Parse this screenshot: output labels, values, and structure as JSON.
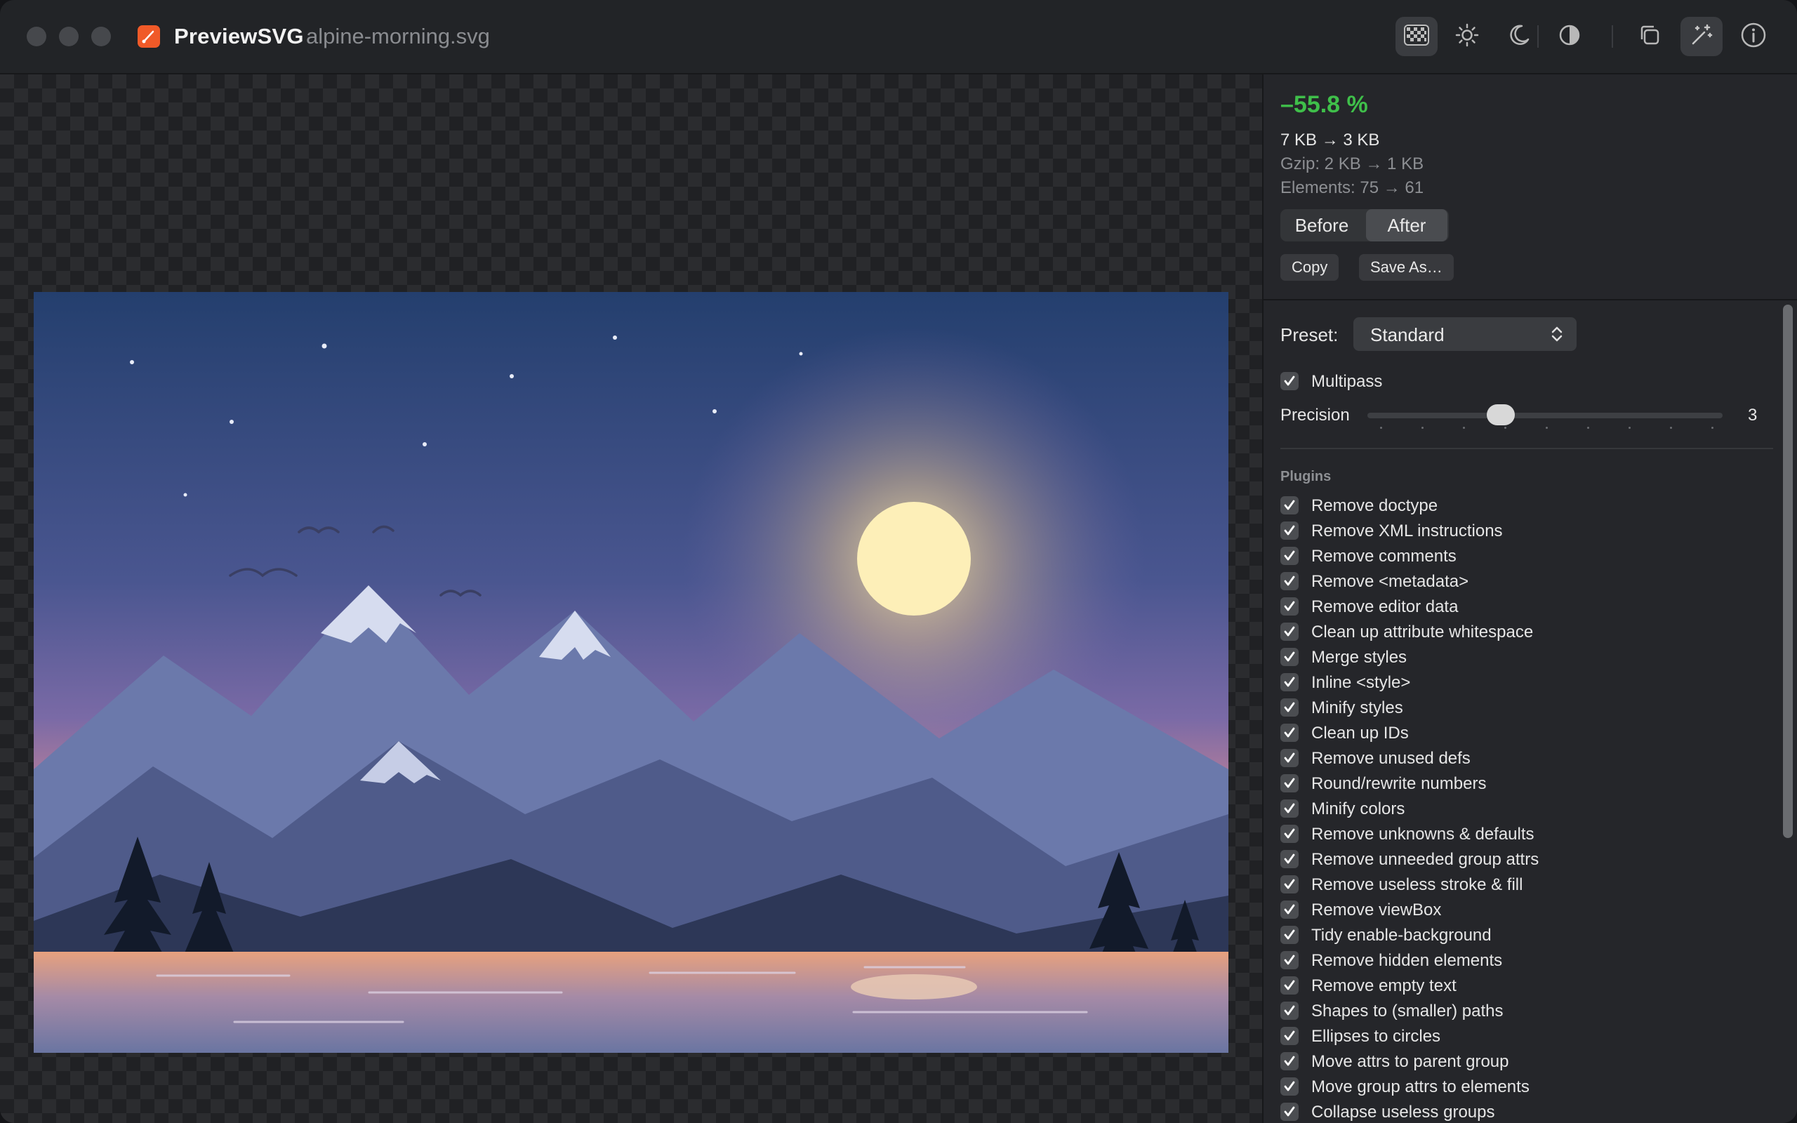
{
  "window": {
    "app_name": "PreviewSVG",
    "file_name": "alpine-morning.svg"
  },
  "toolbar": {
    "buttons": [
      {
        "icon": "checkerboard-icon",
        "active": true
      },
      {
        "icon": "sun-icon",
        "active": false
      },
      {
        "icon": "moon-icon",
        "active": false
      },
      {
        "icon": "contrast-icon",
        "active": false
      },
      {
        "icon": "duplicate-icon",
        "active": false
      },
      {
        "icon": "magic-wand-icon",
        "active": true
      },
      {
        "icon": "info-icon",
        "active": false
      }
    ]
  },
  "stats": {
    "reduction": "–55.8 %",
    "size": "7 KB → 3 KB",
    "gzip": "Gzip: 2 KB → 1 KB",
    "elements": "Elements: 75 → 61"
  },
  "view_toggle": {
    "before_label": "Before",
    "after_label": "After",
    "selected": "After"
  },
  "actions": {
    "copy_label": "Copy",
    "save_label": "Save As…"
  },
  "preset": {
    "label": "Preset:",
    "value": "Standard"
  },
  "options": {
    "multipass_label": "Multipass",
    "multipass_checked": true,
    "precision_label": "Precision",
    "precision_value": "3",
    "precision_fraction": 0.375
  },
  "plugins": {
    "title": "Plugins",
    "items": [
      {
        "label": "Remove doctype",
        "checked": true
      },
      {
        "label": "Remove XML instructions",
        "checked": true
      },
      {
        "label": "Remove comments",
        "checked": true
      },
      {
        "label": "Remove <metadata>",
        "checked": true
      },
      {
        "label": "Remove editor data",
        "checked": true
      },
      {
        "label": "Clean up attribute whitespace",
        "checked": true
      },
      {
        "label": "Merge styles",
        "checked": true
      },
      {
        "label": "Inline <style>",
        "checked": true
      },
      {
        "label": "Minify styles",
        "checked": true
      },
      {
        "label": "Clean up IDs",
        "checked": true
      },
      {
        "label": "Remove unused defs",
        "checked": true
      },
      {
        "label": "Round/rewrite numbers",
        "checked": true
      },
      {
        "label": "Minify colors",
        "checked": true
      },
      {
        "label": "Remove unknowns & defaults",
        "checked": true
      },
      {
        "label": "Remove unneeded group attrs",
        "checked": true
      },
      {
        "label": "Remove useless stroke & fill",
        "checked": true
      },
      {
        "label": "Remove viewBox",
        "checked": true
      },
      {
        "label": "Tidy enable-background",
        "checked": true
      },
      {
        "label": "Remove hidden elements",
        "checked": true
      },
      {
        "label": "Remove empty text",
        "checked": true
      },
      {
        "label": "Shapes to (smaller) paths",
        "checked": true
      },
      {
        "label": "Ellipses to circles",
        "checked": true
      },
      {
        "label": "Move attrs to parent group",
        "checked": true
      },
      {
        "label": "Move group attrs to elements",
        "checked": true
      },
      {
        "label": "Collapse useless groups",
        "checked": true
      }
    ]
  },
  "colors": {
    "accent_green": "#3fbf4a",
    "app_icon": "#f05a28"
  }
}
